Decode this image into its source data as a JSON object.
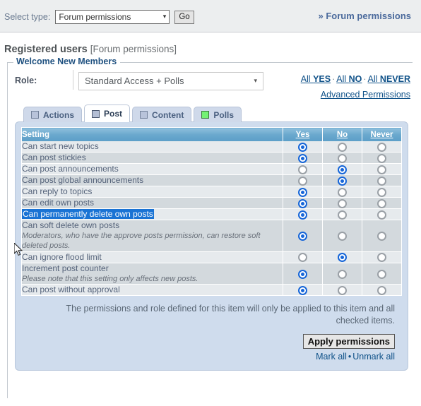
{
  "topbar": {
    "select_type_label": "Select type:",
    "type_value": "Forum permissions",
    "go_label": "Go",
    "breadcrumb_sep": "»",
    "breadcrumb_text": "Forum permissions"
  },
  "page": {
    "title_main": "Registered users",
    "title_sub": "[Forum permissions]",
    "legend": "Welcome New Members"
  },
  "role": {
    "label": "Role:",
    "value": "Standard Access + Polls",
    "all_yes": "All YES",
    "all_no": "All NO",
    "all_never": "All NEVER",
    "separator": "·",
    "advanced": "Advanced Permissions"
  },
  "tabs": [
    {
      "label": "Actions",
      "square": "blue",
      "active": false
    },
    {
      "label": "Post",
      "square": "blue",
      "active": true
    },
    {
      "label": "Content",
      "square": "blue",
      "active": false
    },
    {
      "label": "Polls",
      "square": "green",
      "active": false
    }
  ],
  "table": {
    "headers": {
      "setting": "Setting",
      "yes": "Yes",
      "no": "No",
      "never": "Never"
    },
    "rows": [
      {
        "label": "Can start new topics",
        "note": "",
        "value": "yes",
        "highlighted": false
      },
      {
        "label": "Can post stickies",
        "note": "",
        "value": "yes",
        "highlighted": false
      },
      {
        "label": "Can post announcements",
        "note": "",
        "value": "no",
        "highlighted": false
      },
      {
        "label": "Can post global announcements",
        "note": "",
        "value": "no",
        "highlighted": false
      },
      {
        "label": "Can reply to topics",
        "note": "",
        "value": "yes",
        "highlighted": false
      },
      {
        "label": "Can edit own posts",
        "note": "",
        "value": "yes",
        "highlighted": false
      },
      {
        "label": "Can permanently delete own posts",
        "note": "",
        "value": "yes",
        "highlighted": true
      },
      {
        "label": "Can soft delete own posts",
        "note": "Moderators, who have the approve posts permission, can restore soft deleted posts.",
        "value": "yes",
        "highlighted": false
      },
      {
        "label": "Can ignore flood limit",
        "note": "",
        "value": "no",
        "highlighted": false
      },
      {
        "label": "Increment post counter",
        "note": "Please note that this setting only affects new posts.",
        "value": "yes",
        "highlighted": false
      },
      {
        "label": "Can post without approval",
        "note": "",
        "value": "yes",
        "highlighted": false
      }
    ]
  },
  "footer": {
    "note": "The permissions and role defined for this item will only be applied to this item and all checked items.",
    "apply_label": "Apply permissions",
    "mark_all": "Mark all",
    "bullet": "•",
    "unmark_all": "Unmark all"
  },
  "colors": {
    "accent": "#105289",
    "header_blue": "#5b9ec8",
    "panel_blue": "#cfdced",
    "radio_on": "#1565d8",
    "selection_blue": "#1a73d4",
    "polls_green": "#74f274"
  }
}
